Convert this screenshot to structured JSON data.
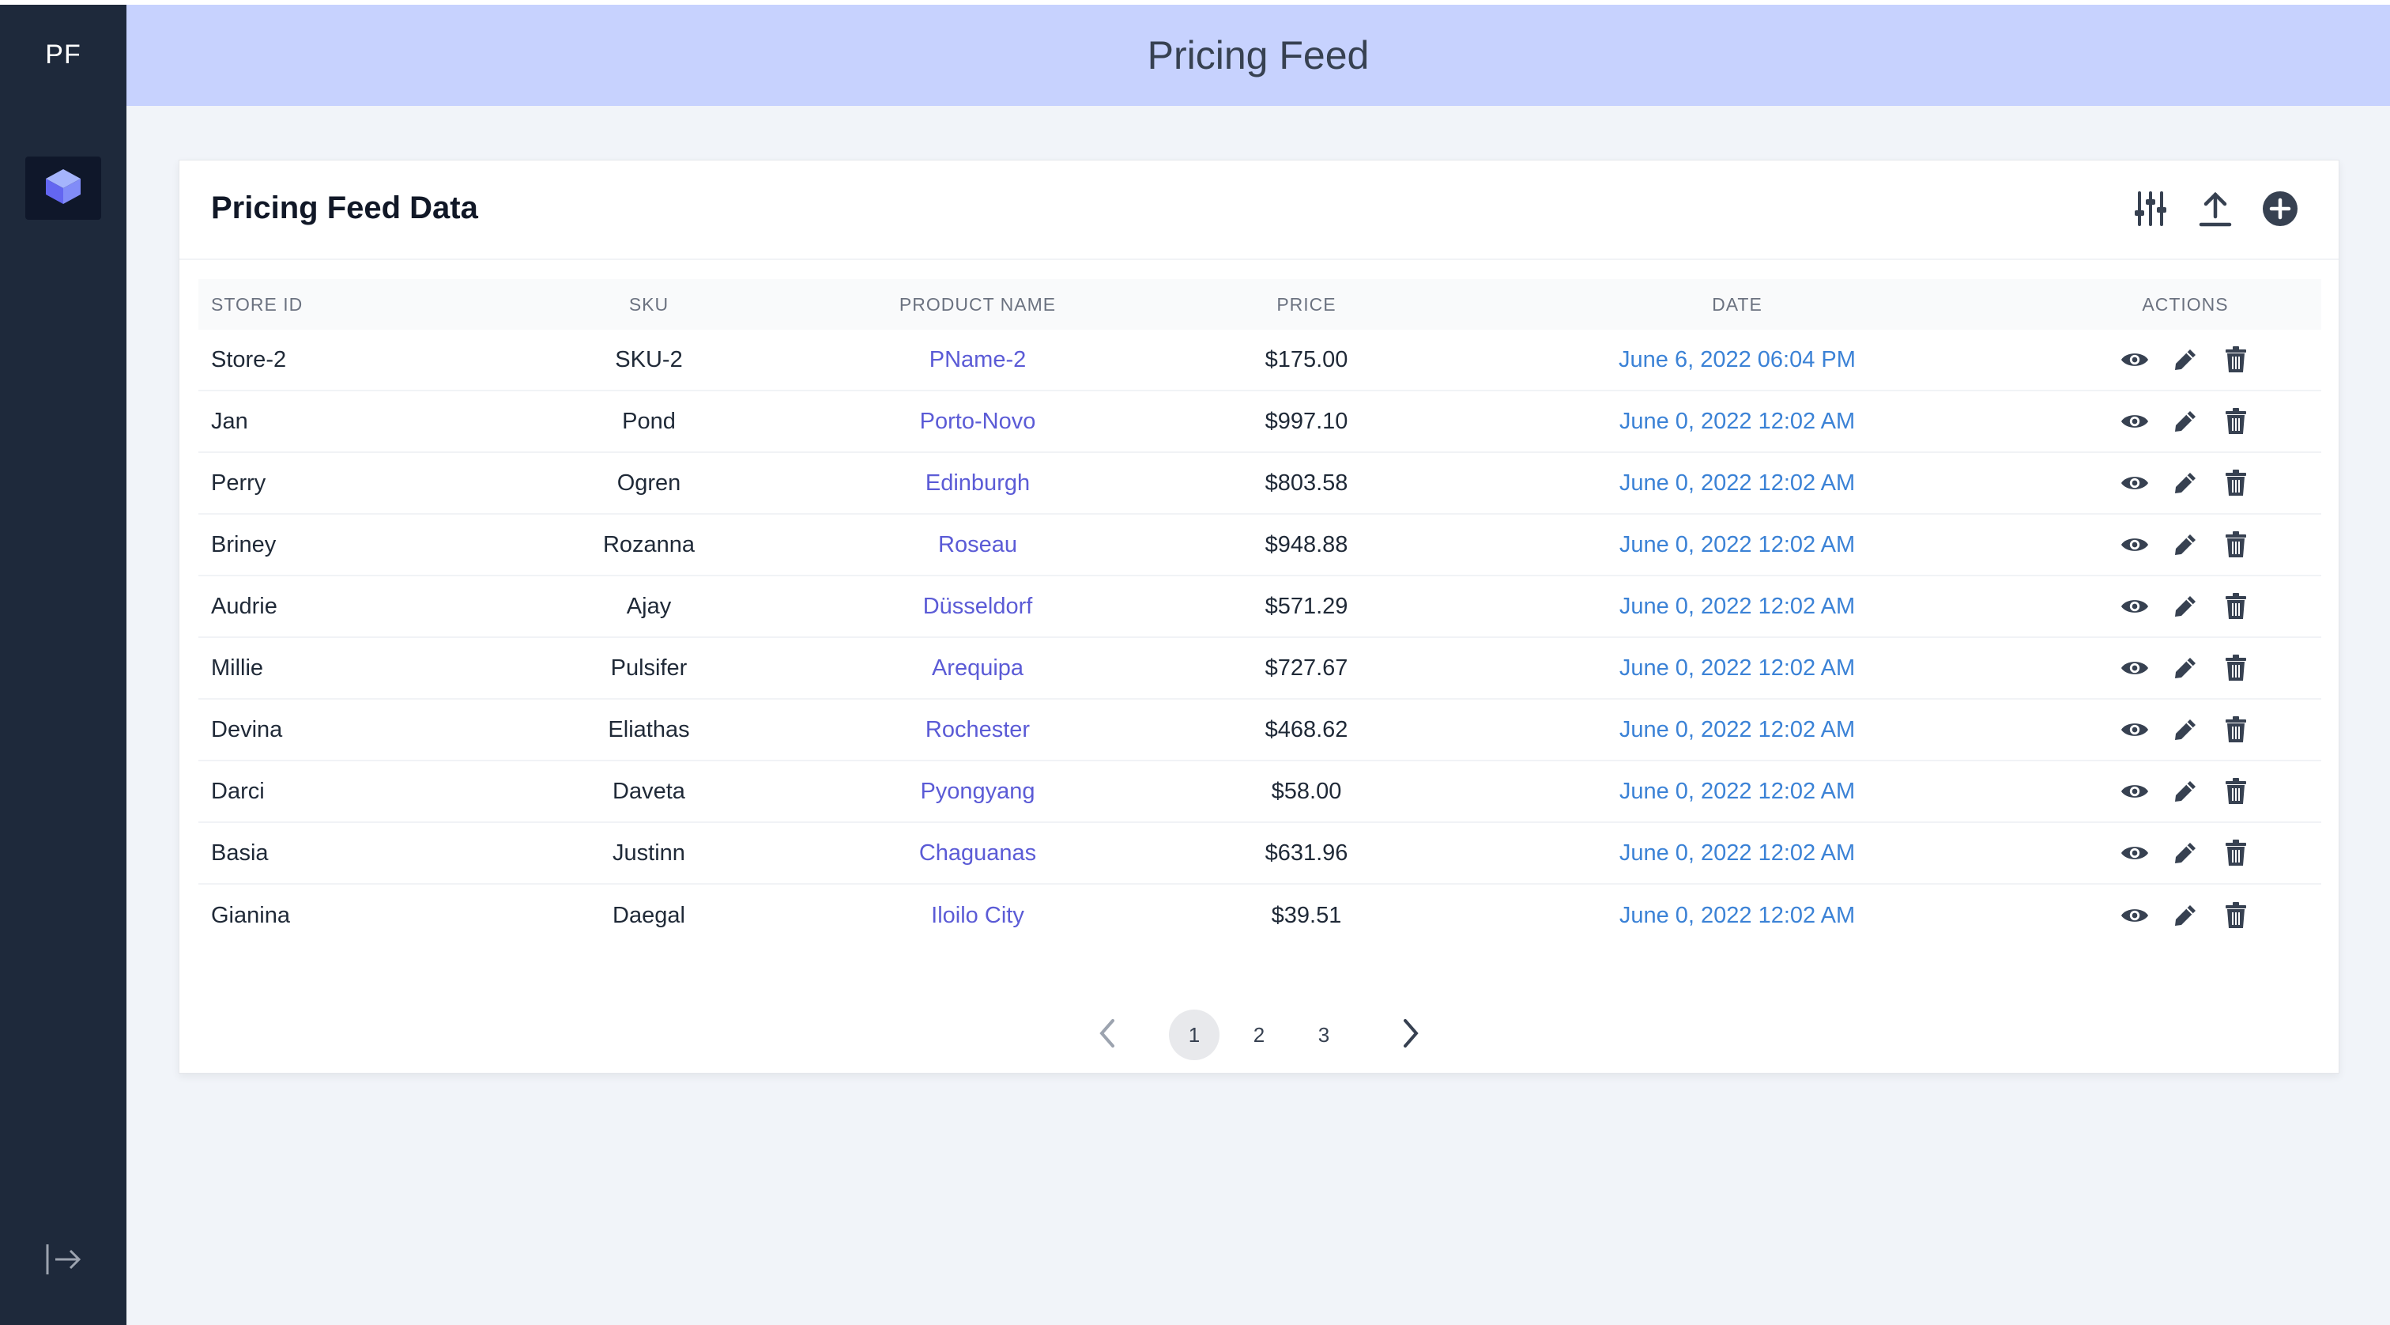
{
  "sidebar": {
    "brand": "PF",
    "items": [
      {
        "icon": "cube-icon"
      }
    ],
    "logout_icon": "logout-arrow-icon"
  },
  "header": {
    "title": "Pricing Feed"
  },
  "card": {
    "title": "Pricing Feed Data",
    "toolbar": [
      {
        "icon": "filter-sliders-icon"
      },
      {
        "icon": "upload-icon"
      },
      {
        "icon": "add-circle-icon"
      }
    ]
  },
  "table": {
    "columns": [
      "STORE ID",
      "SKU",
      "PRODUCT NAME",
      "PRICE",
      "DATE",
      "ACTIONS"
    ],
    "rows": [
      {
        "store_id": "Store-2",
        "sku": "SKU-2",
        "product_name": "PName-2",
        "price": "$175.00",
        "date": "June 6, 2022 06:04 PM"
      },
      {
        "store_id": "Jan",
        "sku": "Pond",
        "product_name": "Porto-Novo",
        "price": "$997.10",
        "date": "June 0, 2022 12:02 AM"
      },
      {
        "store_id": "Perry",
        "sku": "Ogren",
        "product_name": "Edinburgh",
        "price": "$803.58",
        "date": "June 0, 2022 12:02 AM"
      },
      {
        "store_id": "Briney",
        "sku": "Rozanna",
        "product_name": "Roseau",
        "price": "$948.88",
        "date": "June 0, 2022 12:02 AM"
      },
      {
        "store_id": "Audrie",
        "sku": "Ajay",
        "product_name": "Düsseldorf",
        "price": "$571.29",
        "date": "June 0, 2022 12:02 AM"
      },
      {
        "store_id": "Millie",
        "sku": "Pulsifer",
        "product_name": "Arequipa",
        "price": "$727.67",
        "date": "June 0, 2022 12:02 AM"
      },
      {
        "store_id": "Devina",
        "sku": "Eliathas",
        "product_name": "Rochester",
        "price": "$468.62",
        "date": "June 0, 2022 12:02 AM"
      },
      {
        "store_id": "Darci",
        "sku": "Daveta",
        "product_name": "Pyongyang",
        "price": "$58.00",
        "date": "June 0, 2022 12:02 AM"
      },
      {
        "store_id": "Basia",
        "sku": "Justinn",
        "product_name": "Chaguanas",
        "price": "$631.96",
        "date": "June 0, 2022 12:02 AM"
      },
      {
        "store_id": "Gianina",
        "sku": "Daegal",
        "product_name": "Iloilo City",
        "price": "$39.51",
        "date": "June 0, 2022 12:02 AM"
      }
    ],
    "row_actions": [
      "view-eye-icon",
      "edit-pencil-icon",
      "delete-trash-icon"
    ]
  },
  "pagination": {
    "pages": [
      "1",
      "2",
      "3"
    ],
    "current": "1"
  },
  "colors": {
    "sidebar_bg": "#1e293b",
    "header_bg": "#c7d2fe",
    "link": "#5b5bd6",
    "date": "#3b82d6",
    "accent": "#6366f1"
  }
}
